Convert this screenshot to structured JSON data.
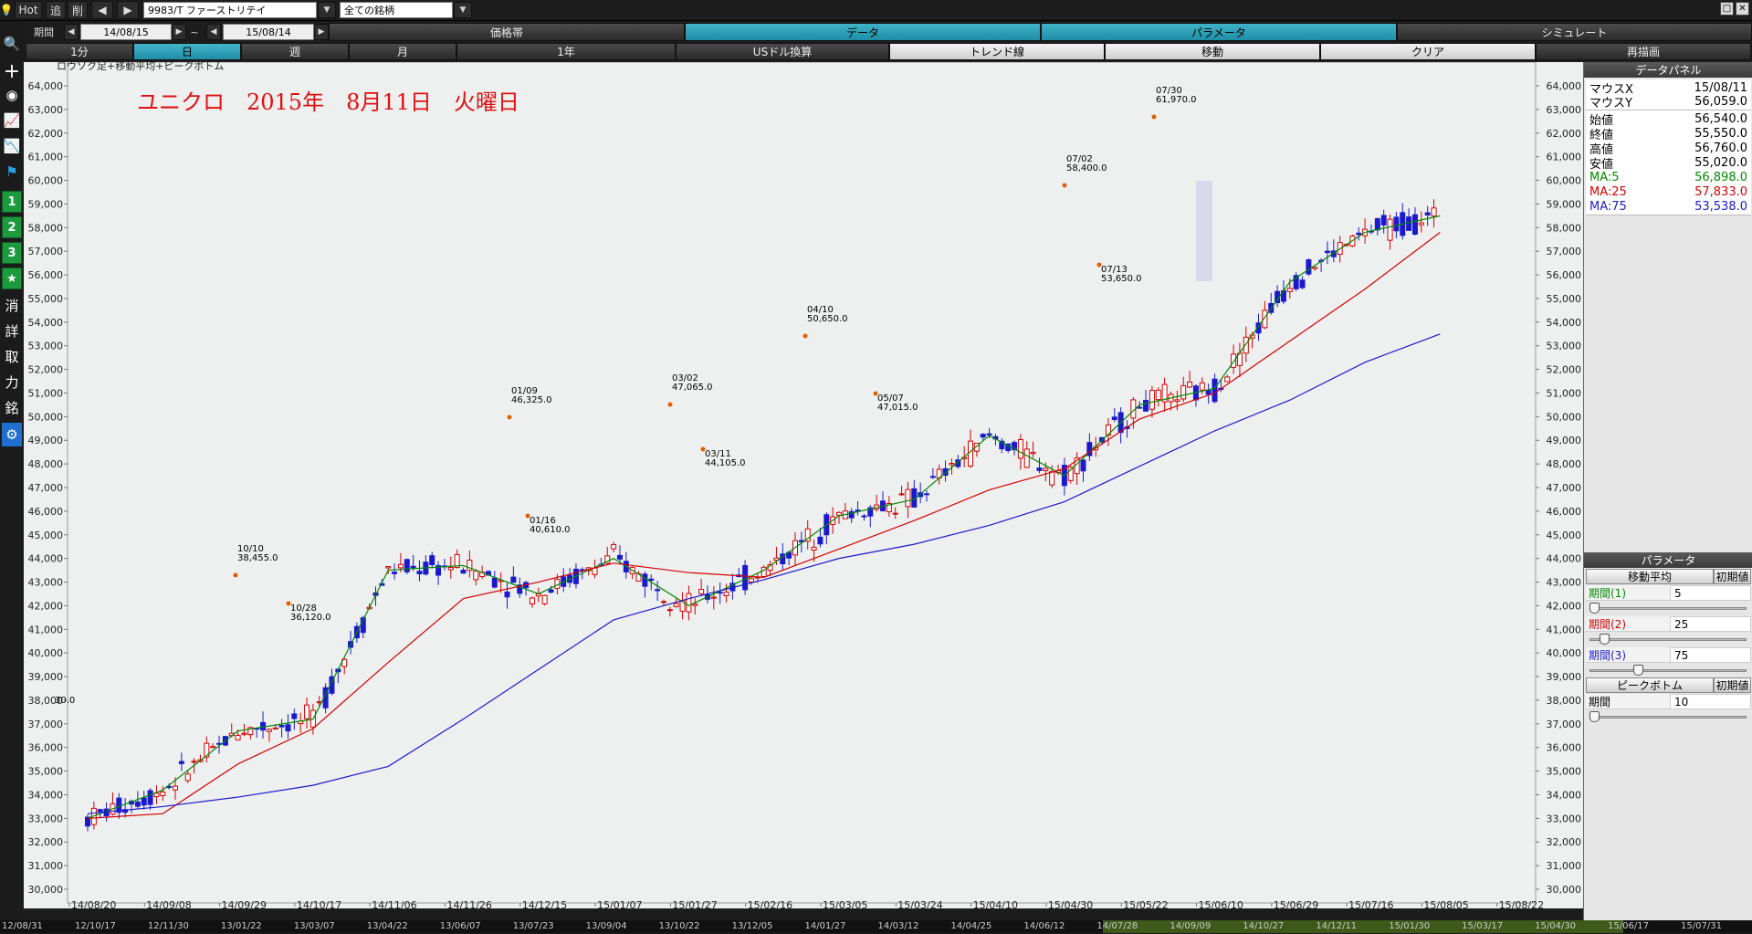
{
  "toolbar": {
    "hot_label": "Hot",
    "add_label": "追",
    "del_label": "削",
    "symbol_value": "9983/T ファーストリテイ",
    "universe_value": "全ての銘柄"
  },
  "window_controls": {
    "minimize": "□",
    "close": "✕"
  },
  "period": {
    "label": "期間",
    "start": "14/08/15",
    "tilde": "~",
    "end": "15/08/14"
  },
  "top_tabs": [
    {
      "label": "価格帯",
      "active": false
    },
    {
      "label": "データ",
      "active": true
    },
    {
      "label": "パラメータ",
      "active": true
    },
    {
      "label": "シミュレート",
      "active": false
    }
  ],
  "row3": {
    "interval_1min": "1分",
    "interval_day": "日",
    "interval_week": "週",
    "interval_month": "月",
    "interval_year": "1年",
    "usd_convert": "USドル換算",
    "trendline": "トレンド線",
    "move": "移動",
    "clear": "クリア",
    "redraw": "再描画"
  },
  "left_tools": [
    {
      "name": "search-icon",
      "glyph": "🔍"
    },
    {
      "name": "crosshair-icon",
      "glyph": "+"
    },
    {
      "name": "camera-icon",
      "glyph": "◉"
    },
    {
      "name": "line-chart-icon",
      "glyph": "📈"
    },
    {
      "name": "line-chart-alt-icon",
      "glyph": "📉"
    },
    {
      "name": "flag-icon",
      "glyph": "⚑"
    }
  ],
  "left_numbers": [
    "1",
    "2",
    "3"
  ],
  "left_star": "★",
  "left_kanji": [
    "消",
    "詳",
    "取",
    "力",
    "銘"
  ],
  "left_gear": "⚙",
  "chart": {
    "legend": "ロウソク足+移動平均+ピークボトム",
    "title": "ユニクロ　2015年　8月11日　火曜日",
    "price_ticks": [
      "30,000",
      "31,000",
      "32,000",
      "33,000",
      "34,000",
      "35,000",
      "36,000",
      "37,000",
      "38,000",
      "39,000",
      "40,000",
      "41,000",
      "42,000",
      "43,000",
      "44,000",
      "45,000",
      "46,000",
      "47,000",
      "48,000",
      "49,000",
      "50,000",
      "51,000",
      "52,000",
      "53,000",
      "54,000",
      "55,000",
      "56,000",
      "57,000",
      "58,000",
      "59,000",
      "60,000",
      "61,000",
      "62,000",
      "63,000",
      "64,000"
    ],
    "date_ticks": [
      "14/08/20",
      "14/09/08",
      "14/09/29",
      "14/10/17",
      "14/11/06",
      "14/11/26",
      "14/12/15",
      "15/01/07",
      "15/01/27",
      "15/02/16",
      "15/03/05",
      "15/03/24",
      "15/04/10",
      "15/04/30",
      "15/05/22",
      "15/06/10",
      "15/06/29",
      "15/07/16",
      "15/08/05",
      "15/08/22"
    ],
    "peaks": [
      {
        "date": "10/10",
        "value": "38,455.0"
      },
      {
        "date": "10/28",
        "value": "36,120.0"
      },
      {
        "date": "01/09",
        "value": "46,325.0"
      },
      {
        "date": "01/16",
        "value": "40,610.0"
      },
      {
        "date": "03/02",
        "value": "47,065.0"
      },
      {
        "date": "03/11",
        "value": "44,105.0"
      },
      {
        "date": "04/10",
        "value": "50,650.0"
      },
      {
        "date": "05/07",
        "value": "47,015.0"
      },
      {
        "date": "07/02",
        "value": "58,400.0"
      },
      {
        "date": "07/13",
        "value": "53,650.0"
      },
      {
        "date": "07/30",
        "value": "61,970.0"
      }
    ],
    "left_edge_label": "30.0"
  },
  "chart_data": {
    "type": "line",
    "title": "ユニクロ　2015年　8月11日　火曜日",
    "ylim": [
      30000,
      64000
    ],
    "x": [
      "14/08/20",
      "14/09/08",
      "14/09/29",
      "14/10/17",
      "14/11/06",
      "14/11/26",
      "14/12/15",
      "15/01/07",
      "15/01/27",
      "15/02/16",
      "15/03/05",
      "15/03/24",
      "15/04/10",
      "15/04/30",
      "15/05/22",
      "15/06/10",
      "15/06/29",
      "15/07/16",
      "15/08/05"
    ],
    "series": [
      {
        "name": "MA:5",
        "values": [
          33000,
          34200,
          36700,
          37200,
          43500,
          43700,
          42500,
          44000,
          42000,
          43500,
          45800,
          46500,
          49200,
          47500,
          50500,
          51200,
          55700,
          57800,
          58500
        ]
      },
      {
        "name": "MA:25",
        "values": [
          33000,
          33200,
          35300,
          36800,
          39600,
          42300,
          43000,
          43800,
          43400,
          43200,
          44400,
          45600,
          46900,
          47800,
          49900,
          51000,
          53200,
          55400,
          57800
        ]
      },
      {
        "name": "MA:75",
        "values": [
          33200,
          33500,
          33900,
          34400,
          35200,
          37200,
          39300,
          41400,
          42300,
          43100,
          44000,
          44600,
          45400,
          46400,
          47900,
          49400,
          50700,
          52300,
          53500
        ]
      }
    ]
  },
  "bottom_dates": [
    "12/08/31",
    "12/10/17",
    "12/11/30",
    "13/01/22",
    "13/03/07",
    "13/04/22",
    "13/06/07",
    "13/07/23",
    "13/09/04",
    "13/10/22",
    "13/12/05",
    "14/01/27",
    "14/03/12",
    "14/04/25",
    "14/06/12",
    "14/07/28",
    "14/09/09",
    "14/10/27",
    "14/12/11",
    "15/01/30",
    "15/03/17",
    "15/04/30",
    "15/06/17",
    "15/07/31"
  ],
  "data_panel": {
    "title": "データパネル",
    "rows": [
      {
        "label": "マウスX",
        "value": "15/08/11",
        "color": "#000000"
      },
      {
        "label": "マウスY",
        "value": "56,059.0",
        "color": "#000000"
      },
      {
        "label": "始値",
        "value": "56,540.0",
        "color": "#000000"
      },
      {
        "label": "終値",
        "value": "55,550.0",
        "color": "#000000"
      },
      {
        "label": "高値",
        "value": "56,760.0",
        "color": "#000000"
      },
      {
        "label": "安値",
        "value": "55,020.0",
        "color": "#000000"
      },
      {
        "label": "MA:5",
        "value": "56,898.0",
        "color": "#008a00"
      },
      {
        "label": "MA:25",
        "value": "57,833.0",
        "color": "#d40000"
      },
      {
        "label": "MA:75",
        "value": "53,538.0",
        "color": "#1a1acc"
      }
    ]
  },
  "param_panel": {
    "title": "パラメータ",
    "ma_label": "移動平均",
    "reset_label": "初期値",
    "p1_label": "期間(1)",
    "p1_value": "5",
    "p1_level": 0.0,
    "p2_label": "期間(2)",
    "p2_value": "25",
    "p2_level": 0.07,
    "p3_label": "期間(3)",
    "p3_value": "75",
    "p3_level": 0.3,
    "pb_label": "ピークボトム",
    "pb_reset": "初期値",
    "pb_period_label": "期間",
    "pb_period_value": "10",
    "pb_level": 0.0
  },
  "colors": {
    "ma5": "#008a00",
    "ma25": "#d40000",
    "ma75": "#1a1acc",
    "up_candle": "#d40000",
    "down_candle": "#1a1acc",
    "title_red": "#e01010",
    "tab_active": "#2aa0b8"
  }
}
